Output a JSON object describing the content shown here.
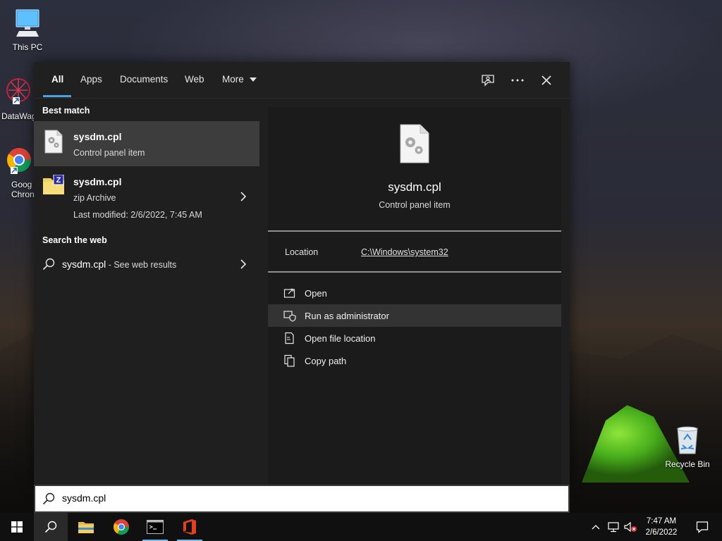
{
  "desktop": {
    "icons": [
      {
        "label": "This PC"
      },
      {
        "label": "DataWag"
      },
      {
        "label": "Goog\nChron"
      },
      {
        "label": "Recycle Bin"
      }
    ]
  },
  "tabs": [
    {
      "label": "All",
      "active": true
    },
    {
      "label": "Apps"
    },
    {
      "label": "Documents"
    },
    {
      "label": "Web"
    },
    {
      "label": "More"
    }
  ],
  "left": {
    "best_match_heading": "Best match",
    "results": [
      {
        "title": "sysdm.cpl",
        "subtitle": "Control panel item",
        "icon": "cpl-file-icon"
      },
      {
        "title": "sysdm.cpl",
        "subtitle": "zip Archive",
        "modified": "Last modified: 2/6/2022, 7:45 AM",
        "icon": "zip-folder-icon"
      }
    ],
    "web_heading": "Search the web",
    "web_query": "sysdm.cpl",
    "web_suffix": " - See web results"
  },
  "preview": {
    "name": "sysdm.cpl",
    "type": "Control panel item",
    "location_label": "Location",
    "location_value": "C:\\Windows\\system32",
    "actions": [
      {
        "label": "Open",
        "icon": "open-icon"
      },
      {
        "label": "Run as administrator",
        "icon": "shield-icon"
      },
      {
        "label": "Open file location",
        "icon": "file-location-icon"
      },
      {
        "label": "Copy path",
        "icon": "copy-icon"
      }
    ]
  },
  "search": {
    "value": "sysdm.cpl"
  },
  "taskbar": {
    "time": "7:47 AM",
    "date": "2/6/2022"
  },
  "colors": {
    "accent": "#4aa3e0",
    "selected": "#3d3d3d",
    "panel": "#1f1f1f"
  }
}
